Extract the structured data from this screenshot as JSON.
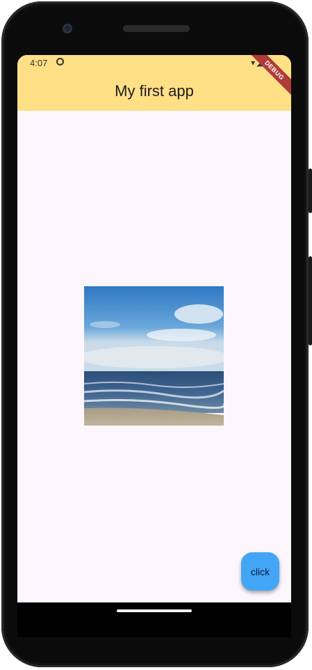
{
  "status_bar": {
    "time": "4:07",
    "icons": "▾◢▮"
  },
  "app_bar": {
    "title": "My first app",
    "background": "#ffe086"
  },
  "debug_banner": {
    "label": "DEBUG"
  },
  "image": {
    "description_icon": "beach-ocean-photo"
  },
  "fab": {
    "label": "click",
    "color": "#42a5f5"
  }
}
